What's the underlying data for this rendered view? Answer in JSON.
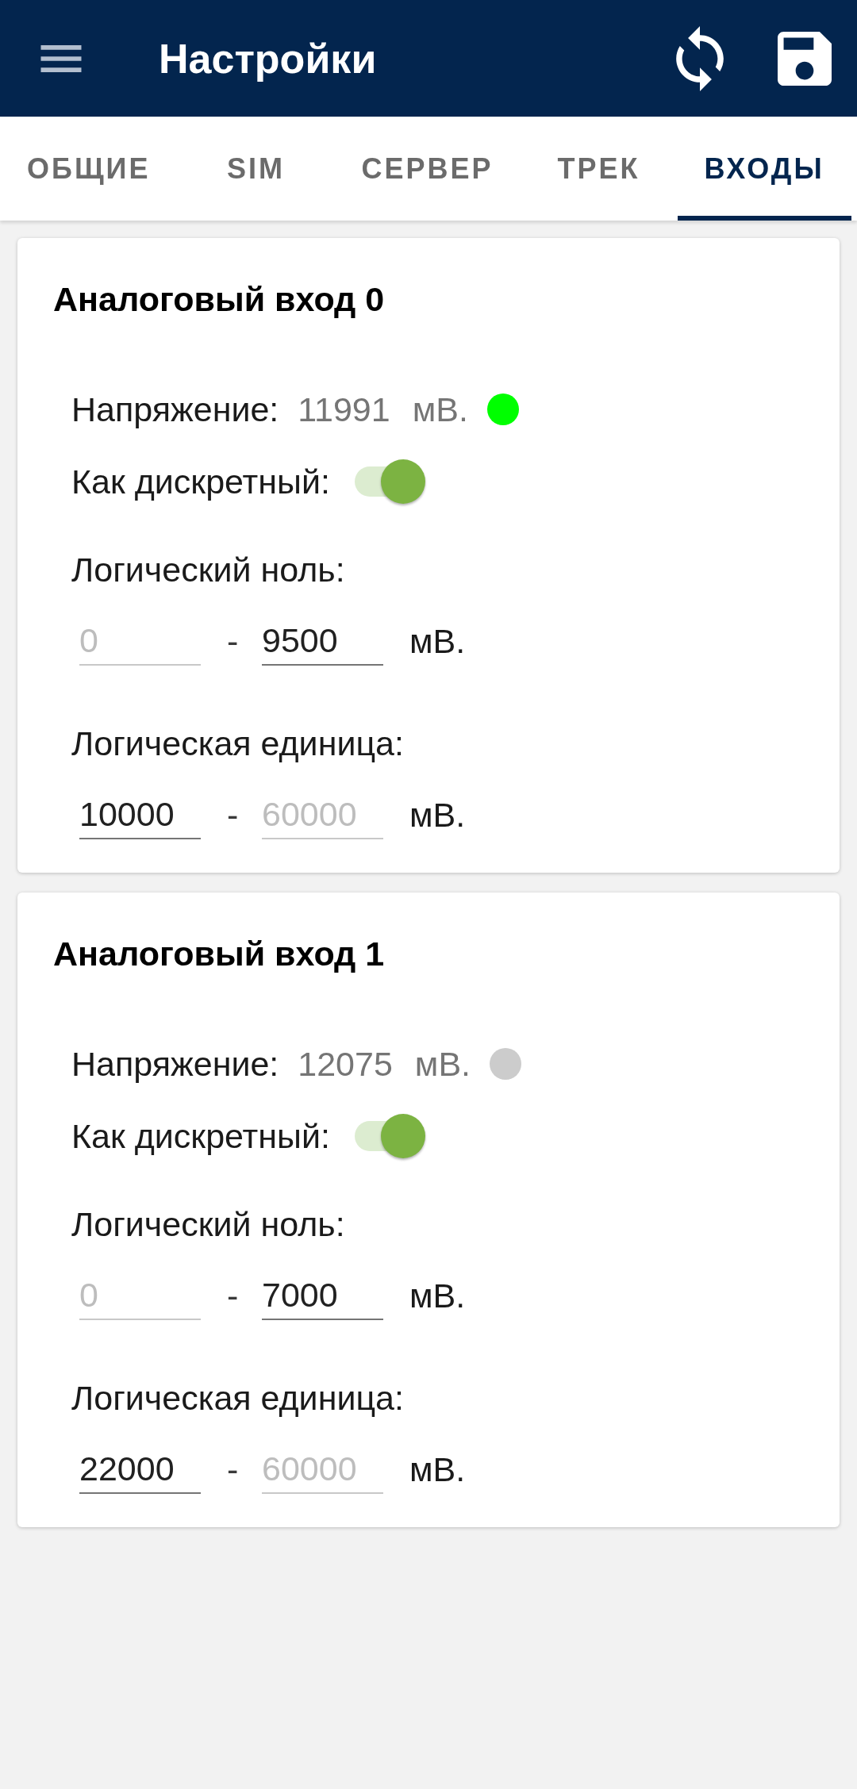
{
  "app_bar": {
    "title": "Настройки"
  },
  "tabs": [
    {
      "label": "ОБЩИЕ",
      "selected": false
    },
    {
      "label": "SIM",
      "selected": false
    },
    {
      "label": "СЕРВЕР",
      "selected": false
    },
    {
      "label": "ТРЕК",
      "selected": false
    },
    {
      "label": "ВХОДЫ",
      "selected": true
    }
  ],
  "inputs": [
    {
      "title": "Аналоговый вход 0",
      "voltage": {
        "label": "Напряжение:",
        "value": "11991",
        "unit": "мВ.",
        "color": "#00ff00"
      },
      "discrete": {
        "label": "Как дискретный:",
        "on": true
      },
      "ranges": [
        {
          "label": "Логический ноль:",
          "from": {
            "value": "0",
            "disabled": true
          },
          "to": {
            "value": "9500",
            "disabled": false
          },
          "separator": "-",
          "unit": "мВ."
        },
        {
          "label": "Логическая единица:",
          "from": {
            "value": "10000",
            "disabled": false
          },
          "to": {
            "value": "60000",
            "disabled": true
          },
          "separator": "-",
          "unit": "мВ."
        }
      ]
    },
    {
      "title": "Аналоговый вход 1",
      "voltage": {
        "label": "Напряжение:",
        "value": "12075",
        "unit": "мВ.",
        "color": "#cccccc"
      },
      "discrete": {
        "label": "Как дискретный:",
        "on": true
      },
      "ranges": [
        {
          "label": "Логический ноль:",
          "from": {
            "value": "0",
            "disabled": true
          },
          "to": {
            "value": "7000",
            "disabled": false
          },
          "separator": "-",
          "unit": "мВ."
        },
        {
          "label": "Логическая единица:",
          "from": {
            "value": "22000",
            "disabled": false
          },
          "to": {
            "value": "60000",
            "disabled": true
          },
          "separator": "-",
          "unit": "мВ."
        }
      ]
    }
  ]
}
